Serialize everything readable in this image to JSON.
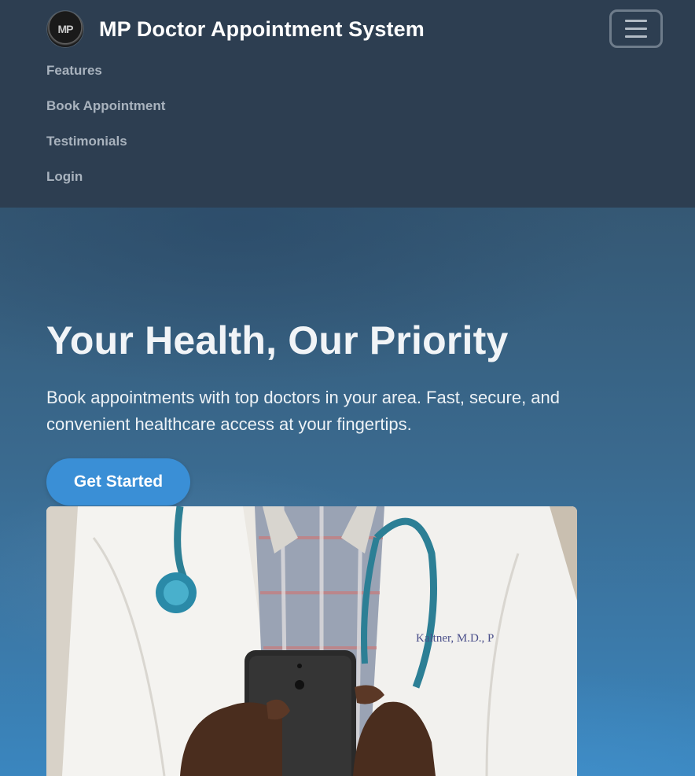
{
  "navbar": {
    "brand_name": "MP Doctor Appointment System",
    "logo_text": "MP",
    "toggle_label": "menu",
    "links": [
      {
        "label": "Features"
      },
      {
        "label": "Book Appointment"
      },
      {
        "label": "Testimonials"
      },
      {
        "label": "Login"
      }
    ]
  },
  "hero": {
    "title": "Your Health, Our Priority",
    "subtitle": "Book appointments with top doctors in your area. Fast, secure, and convenient healthcare access at your fingertips.",
    "cta_label": "Get Started",
    "image_alt": "Doctor in white coat with stethoscope holding a smartphone",
    "coat_text": "Kaltner, M.D., P"
  },
  "colors": {
    "navbar_bg": "#2d3e51",
    "nav_link": "#a9b3be",
    "cta_bg": "#3a8fd6",
    "hero_bg": "#3a6a8f"
  },
  "icons": {
    "toggle": "hamburger-icon",
    "logo": "mp-logo-icon"
  }
}
